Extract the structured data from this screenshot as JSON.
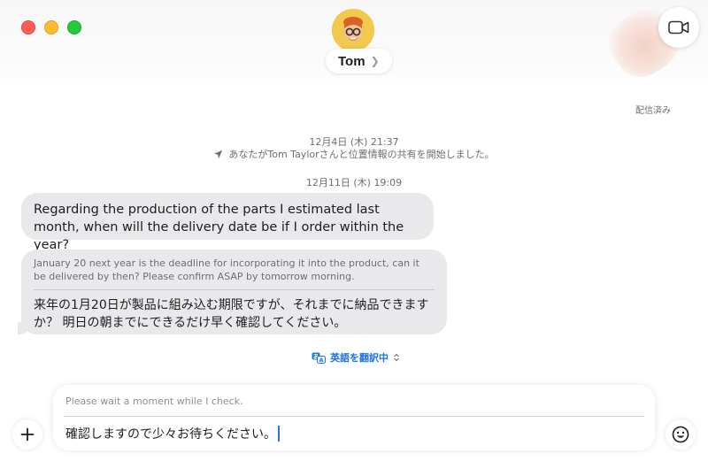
{
  "contact": {
    "name": "Tom",
    "chevron": "❯"
  },
  "status": {
    "delivered": "配信済み"
  },
  "timeline": [
    {
      "timestamp": "12月4日 (木) 21:37",
      "event": "あなたがTom Taylorさんと位置情報の共有を開始しました。"
    },
    {
      "timestamp": "12月11日 (木) 19:09"
    }
  ],
  "messages": [
    {
      "text": "Regarding the production of the parts I estimated last month, when will the delivery date be if I order within the year?"
    },
    {
      "original": "January 20 next year is the deadline for incorporating it into the product, can it be delivered by then? Please confirm ASAP by tomorrow morning.",
      "translation": "来年の1月20日が製品に組み込む期限ですが、それまでに納品できますか？ 明日の朝までにできるだけ早く確認してください。"
    }
  ],
  "translation_status": {
    "label": "英語を翻訳中",
    "icon": "translate-icon"
  },
  "compose": {
    "preview": "Please wait a moment while I check.",
    "value": "確認しますので少々お待ちください。"
  },
  "icons": {
    "facetime": "video-camera-icon",
    "location": "location-arrow-icon",
    "add": "plus-icon",
    "emoji": "emoji-icon"
  },
  "colors": {
    "close": "#ff5f57",
    "minimize": "#febc2e",
    "maximize": "#28c840",
    "bubble": "#e9e9eb",
    "accent": "#1a73e8",
    "caret": "#2f6fed"
  }
}
